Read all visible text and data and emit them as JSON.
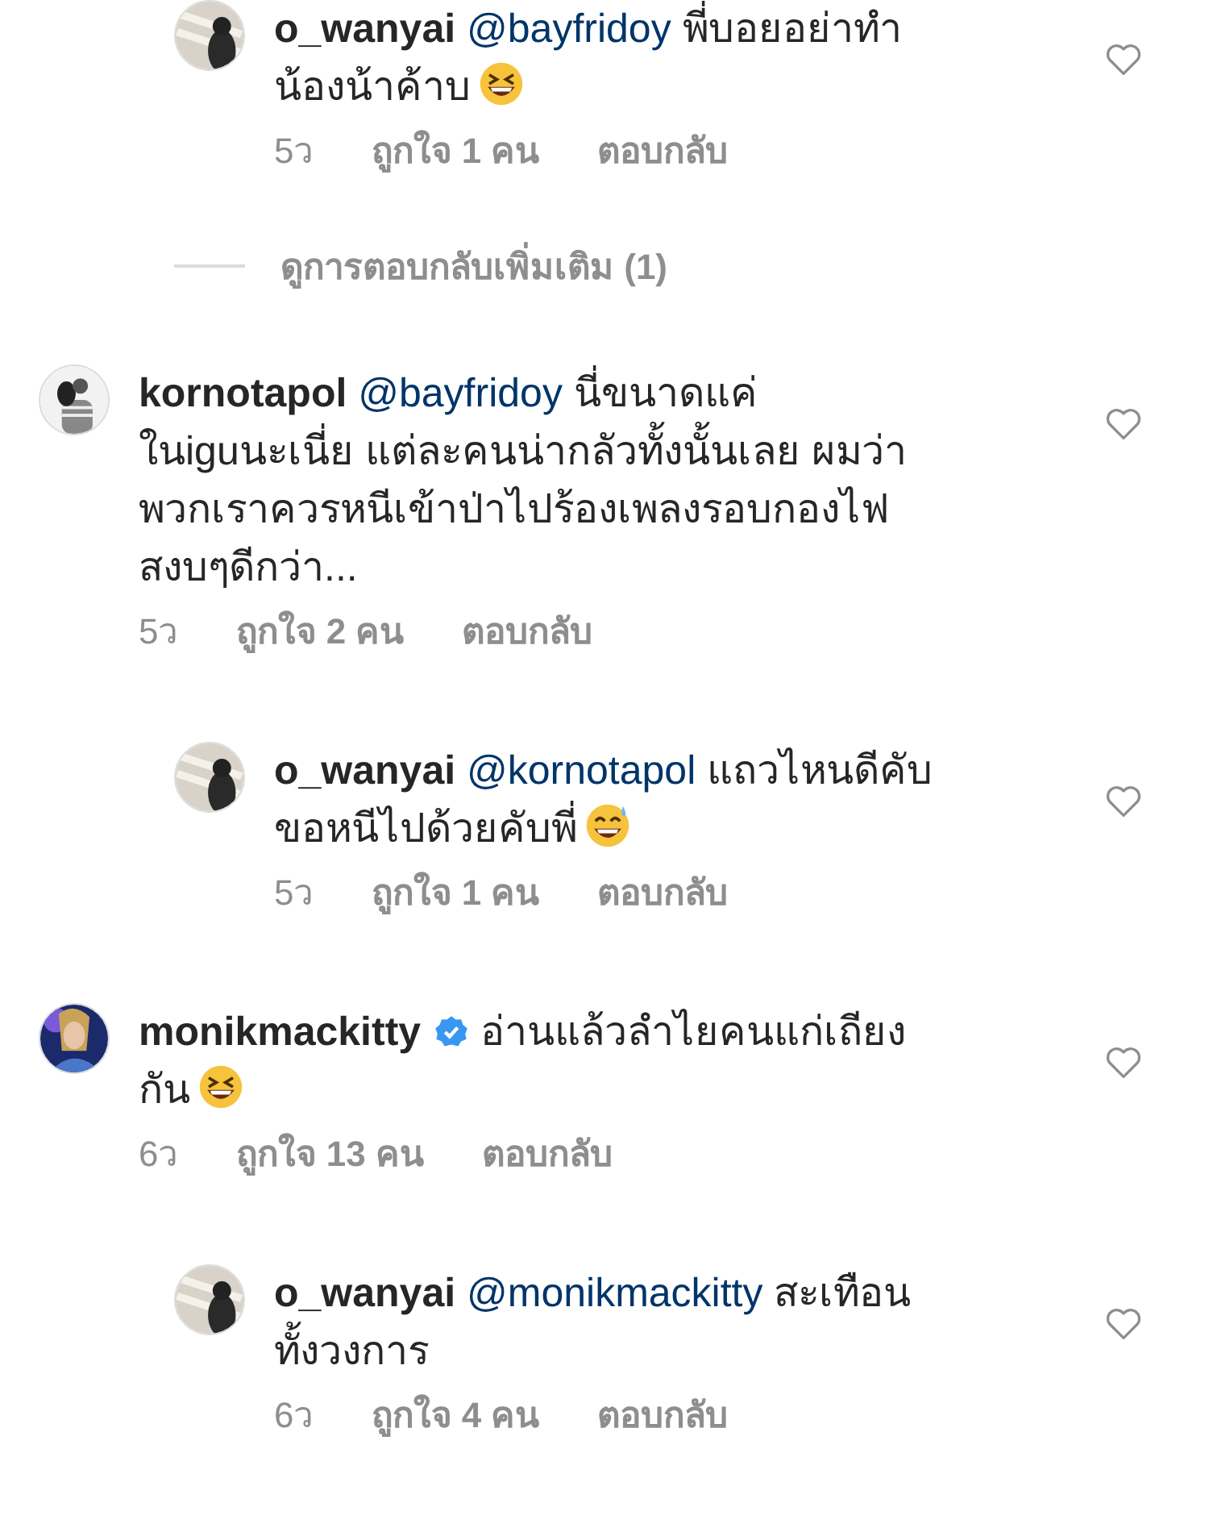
{
  "comments": [
    {
      "kind": "reply",
      "username": "o_wanyai",
      "verified": false,
      "mention": "@bayfridoy",
      "lines": [
        "พี่บอยอย่าทำ",
        "น้องน้าค้าบ"
      ],
      "emoji": {
        "kind": "laughing"
      },
      "age": "5ว",
      "likes": "ถูกใจ 1 คน",
      "reply": "ตอบกลับ",
      "liked": false
    },
    {
      "kind": "more",
      "label": "ดูการตอบกลับเพิ่มเติม (1)"
    },
    {
      "kind": "top",
      "username": "kornotapol",
      "verified": false,
      "mention": "@bayfridoy",
      "lines": [
        "นี่ขนาดแค่",
        "ในiguนะเนี่ย แต่ละคนน่ากลัวทั้งนั้นเลย ผมว่า",
        "พวกเราควรหนีเข้าป่าไปร้องเพลงรอบกองไฟ",
        "สงบๆดีกว่า..."
      ],
      "age": "5ว",
      "likes": "ถูกใจ 2 คน",
      "reply": "ตอบกลับ",
      "liked": false
    },
    {
      "kind": "reply",
      "username": "o_wanyai",
      "verified": false,
      "mention": "@kornotapol",
      "lines": [
        " แถวไหนดีคับ",
        "ขอหนีไปด้วยคับพี่"
      ],
      "emoji": {
        "kind": "sweat"
      },
      "age": "5ว",
      "likes": "ถูกใจ 1 คน",
      "reply": "ตอบกลับ",
      "liked": false
    },
    {
      "kind": "top",
      "username": "monikmackitty",
      "verified": true,
      "lines": [
        "อ่านแล้วลำไยคนแก่เถียง",
        "กัน"
      ],
      "emoji": {
        "kind": "laughing"
      },
      "age": "6ว",
      "likes": "ถูกใจ 13 คน",
      "reply": "ตอบกลับ",
      "liked": false
    },
    {
      "kind": "reply",
      "username": "o_wanyai",
      "verified": false,
      "mention": "@monikmackitty",
      "lines": [
        "สะเทือน",
        "ทั้งวงการ"
      ],
      "age": "6ว",
      "likes": "ถูกใจ 4 คน",
      "reply": "ตอบกลับ",
      "liked": false
    }
  ]
}
